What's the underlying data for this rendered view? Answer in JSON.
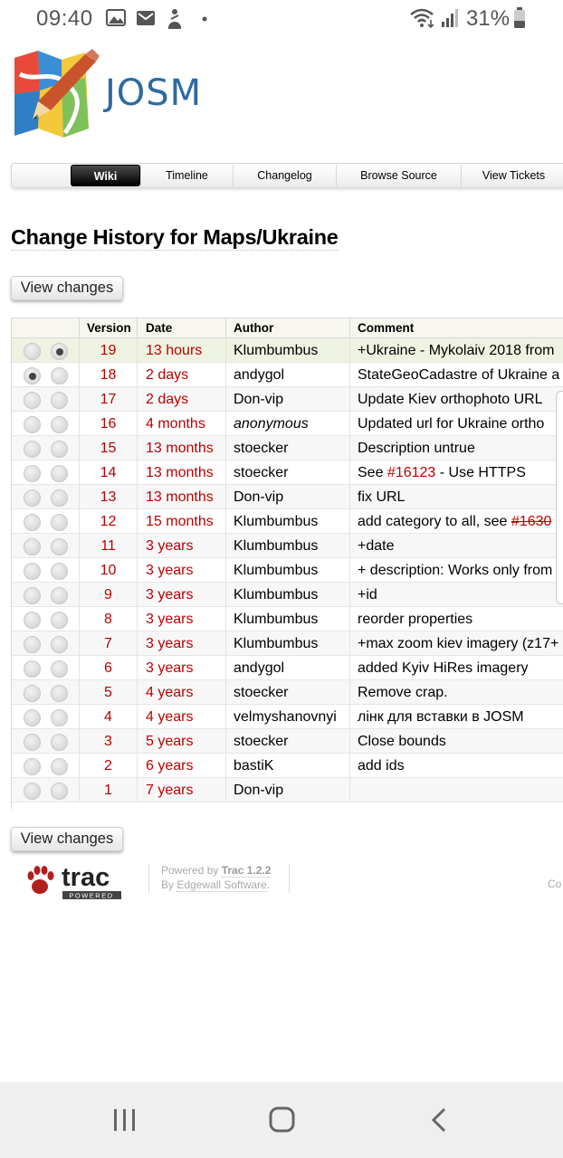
{
  "status_bar": {
    "time": "09:40",
    "left_icons": [
      "image-icon",
      "gmail-icon",
      "person-icon",
      "dot-icon"
    ],
    "right_icons": [
      "wifi-icon",
      "signal-icon",
      "battery-icon"
    ],
    "battery_percent": "31%"
  },
  "header": {
    "logo_text": "JOSM"
  },
  "nav": {
    "tabs": [
      {
        "label": "Wiki",
        "active": true
      },
      {
        "label": "Timeline",
        "active": false
      },
      {
        "label": "Changelog",
        "active": false
      },
      {
        "label": "Browse Source",
        "active": false
      },
      {
        "label": "View Tickets",
        "active": false
      }
    ]
  },
  "page": {
    "title": "Change History for Maps/Ukraine",
    "view_changes_label": "View changes"
  },
  "table": {
    "columns": [
      "",
      "Version",
      "Date",
      "Author",
      "Comment"
    ],
    "rows": [
      {
        "version": "19",
        "date": "13 hours",
        "author": "Klumbumbus",
        "comment": "+Ukraine - Mykolaiv 2018 from",
        "old": false,
        "new": true
      },
      {
        "version": "18",
        "date": "2 days",
        "author": "andygol",
        "comment": "StateGeoCadastre of Ukraine a",
        "old": true,
        "new": false
      },
      {
        "version": "17",
        "date": "2 days",
        "author": "Don-vip",
        "comment": "Update Kiev orthophoto URL",
        "old": false,
        "new": false
      },
      {
        "version": "16",
        "date": "4 months",
        "author": "anonymous",
        "comment": "Updated url for Ukraine ortho",
        "old": false,
        "new": false
      },
      {
        "version": "15",
        "date": "13 months",
        "author": "stoecker",
        "comment": "Description untrue",
        "old": false,
        "new": false
      },
      {
        "version": "14",
        "date": "13 months",
        "author": "stoecker",
        "comment_pre": "See ",
        "comment_link": "#16123",
        "comment_post": " - Use HTTPS",
        "old": false,
        "new": false
      },
      {
        "version": "13",
        "date": "13 months",
        "author": "Don-vip",
        "comment": "fix URL",
        "old": false,
        "new": false
      },
      {
        "version": "12",
        "date": "15 months",
        "author": "Klumbumbus",
        "comment_pre": "add category to all, see ",
        "comment_strike": "#1630",
        "old": false,
        "new": false
      },
      {
        "version": "11",
        "date": "3 years",
        "author": "Klumbumbus",
        "comment": "+date",
        "old": false,
        "new": false
      },
      {
        "version": "10",
        "date": "3 years",
        "author": "Klumbumbus",
        "comment": "+ description: Works only from",
        "old": false,
        "new": false
      },
      {
        "version": "9",
        "date": "3 years",
        "author": "Klumbumbus",
        "comment": "+id",
        "old": false,
        "new": false
      },
      {
        "version": "8",
        "date": "3 years",
        "author": "Klumbumbus",
        "comment": "reorder properties",
        "old": false,
        "new": false
      },
      {
        "version": "7",
        "date": "3 years",
        "author": "Klumbumbus",
        "comment": "+max zoom kiev imagery (z17+",
        "old": false,
        "new": false
      },
      {
        "version": "6",
        "date": "3 years",
        "author": "andygol",
        "comment": "added Kyiv HiRes imagery",
        "old": false,
        "new": false
      },
      {
        "version": "5",
        "date": "4 years",
        "author": "stoecker",
        "comment": "Remove crap.",
        "old": false,
        "new": false
      },
      {
        "version": "4",
        "date": "4 years",
        "author": "velmyshanovnyi",
        "comment": "лінк для вставки в JOSM",
        "old": false,
        "new": false
      },
      {
        "version": "3",
        "date": "5 years",
        "author": "stoecker",
        "comment": "Close bounds",
        "old": false,
        "new": false
      },
      {
        "version": "2",
        "date": "6 years",
        "author": "bastiK",
        "comment": "add ids",
        "old": false,
        "new": false
      },
      {
        "version": "1",
        "date": "7 years",
        "author": "Don-vip",
        "comment": "",
        "old": false,
        "new": false
      }
    ]
  },
  "footer": {
    "trac_logo_text": "trac",
    "trac_logo_sub": "POWERED",
    "powered_by": "Powered by ",
    "trac_version": "Trac 1.2.2",
    "by_text": "By ",
    "edgewall": "Edgewall Software",
    "edgewall_end": ".",
    "right_text": "Co"
  },
  "system_nav": {
    "buttons": [
      "recents-icon",
      "home-icon",
      "back-icon"
    ]
  },
  "colors": {
    "link_red": "#bb0000",
    "josm_blue": "#2d6aa0"
  }
}
